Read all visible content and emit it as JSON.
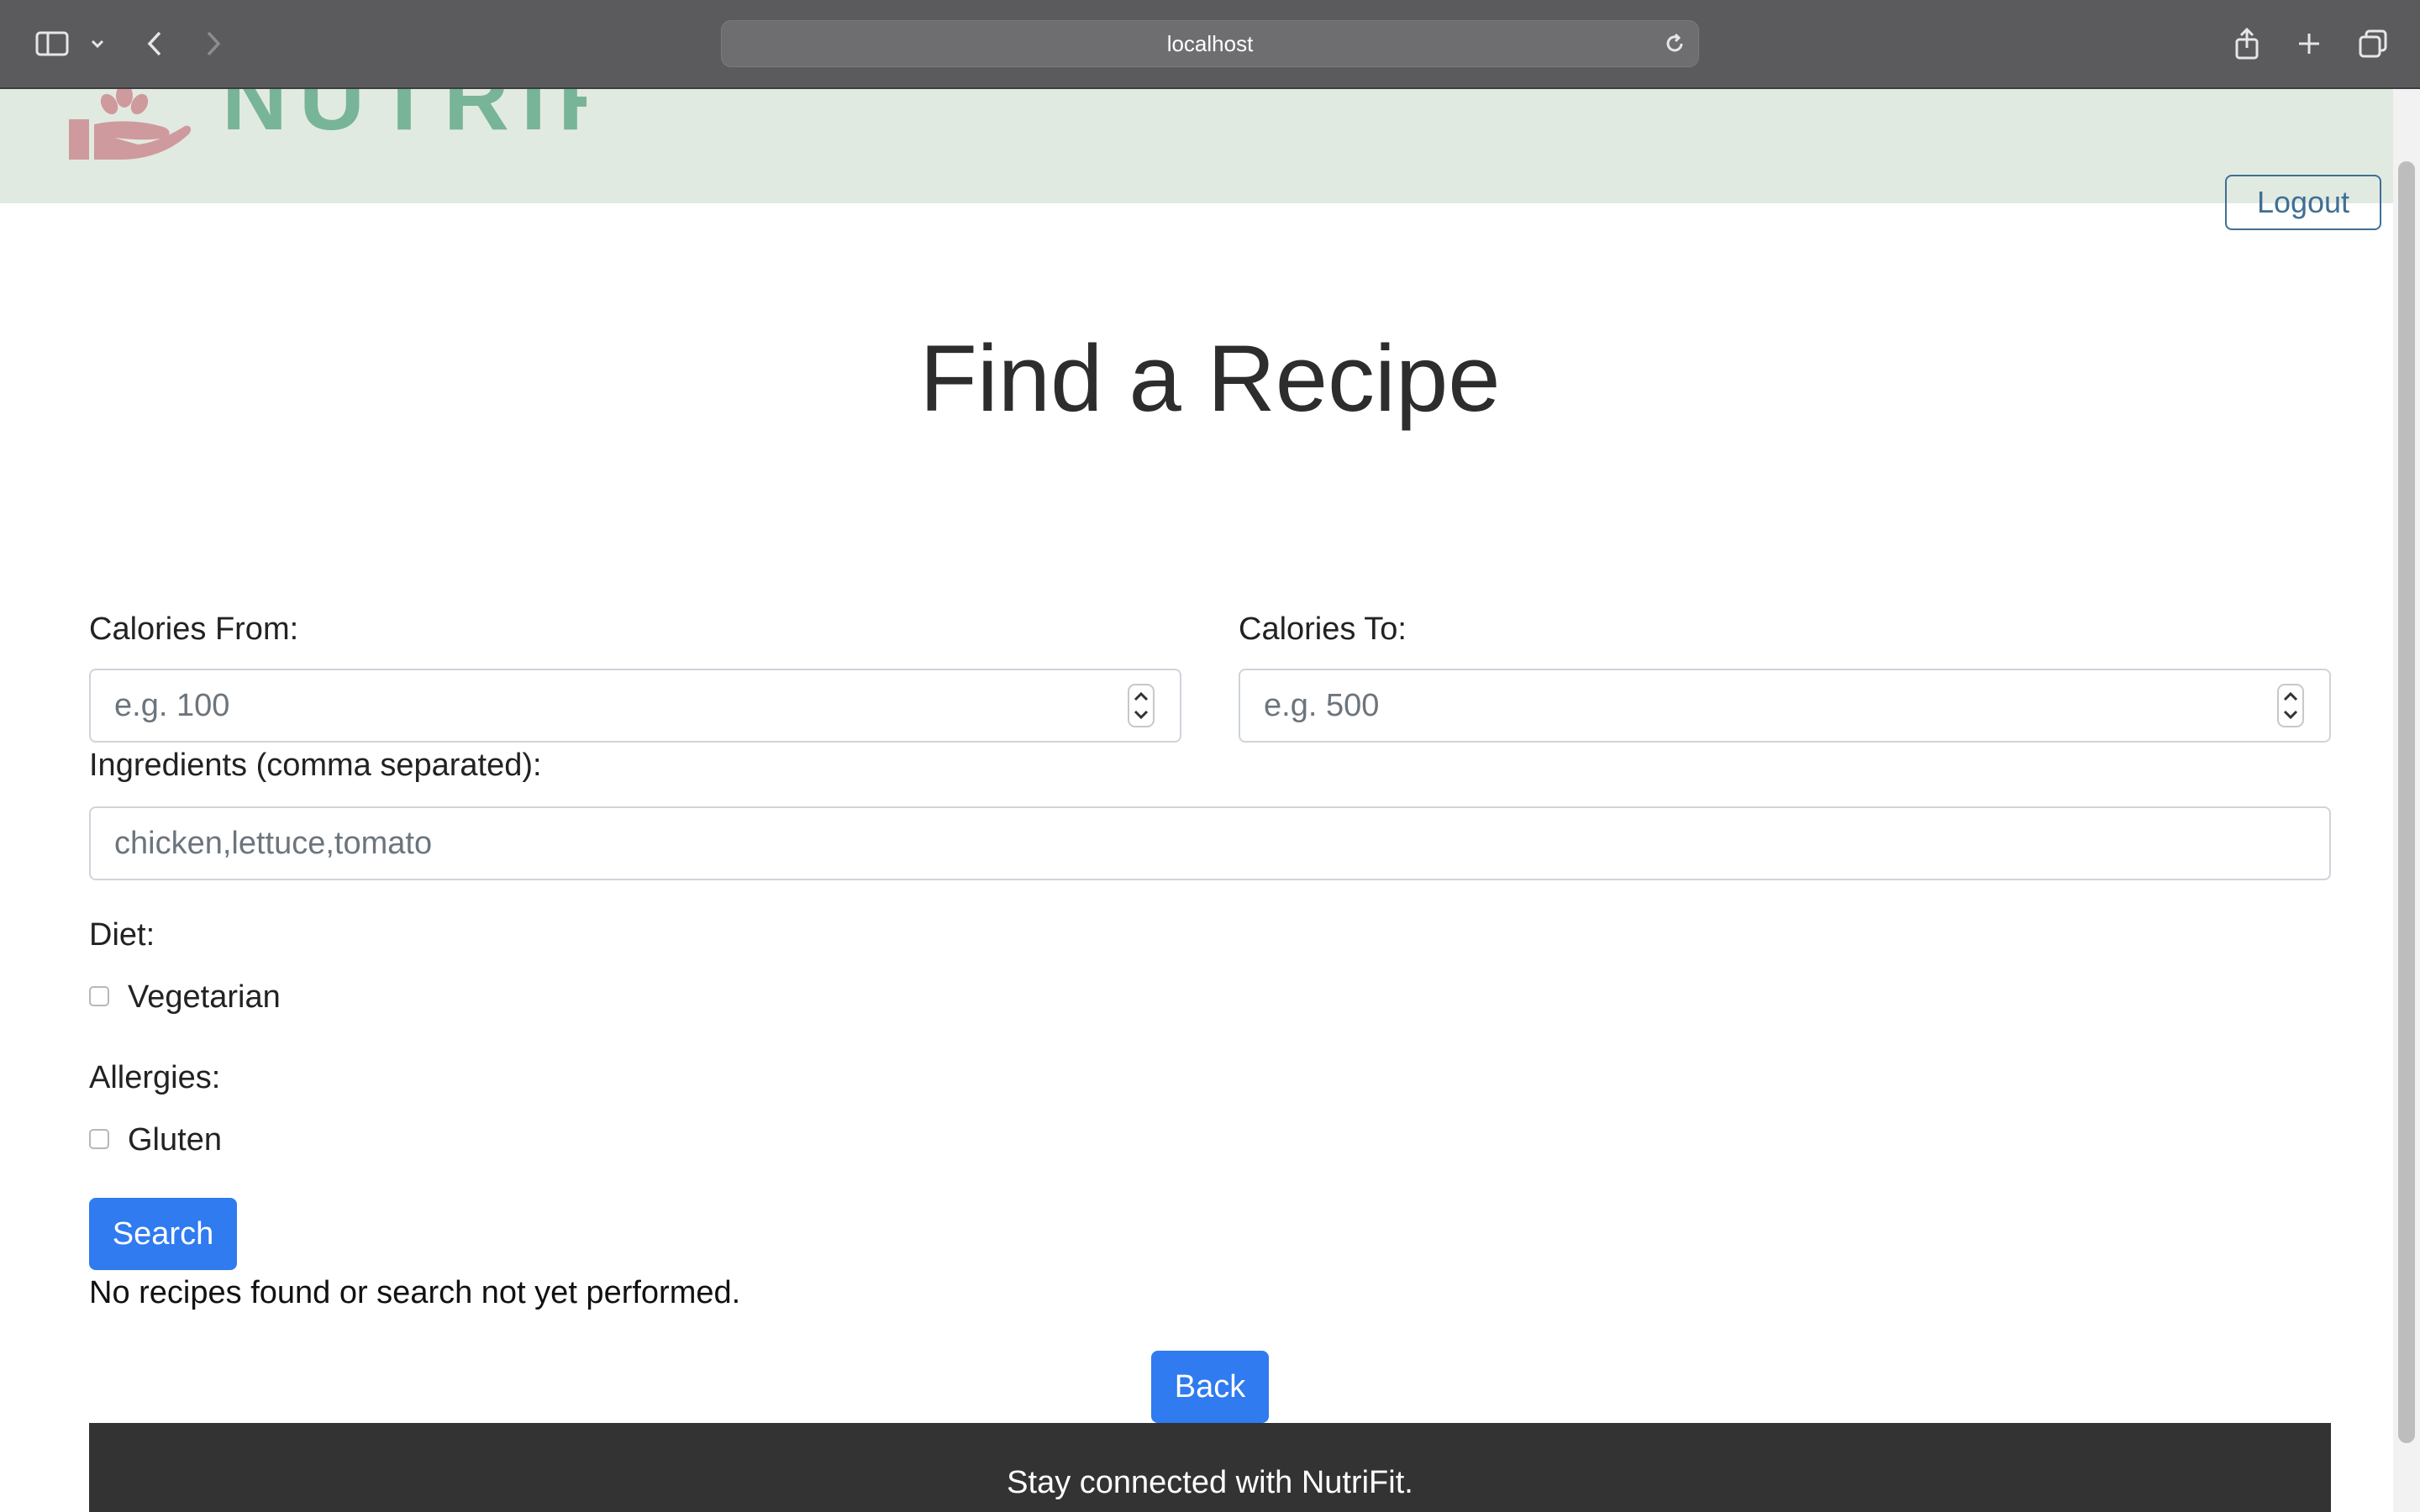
{
  "browser": {
    "url": "localhost"
  },
  "header": {
    "logo_text": "NUTRIFIT",
    "logout_label": "Logout"
  },
  "main": {
    "title": "Find a Recipe",
    "calories_from": {
      "label": "Calories From:",
      "placeholder": "e.g. 100"
    },
    "calories_to": {
      "label": "Calories To:",
      "placeholder": "e.g. 500"
    },
    "ingredients": {
      "label": "Ingredients (comma separated):",
      "placeholder": "chicken,lettuce,tomato"
    },
    "diet": {
      "label": "Diet:",
      "options": [
        {
          "label": "Vegetarian",
          "checked": false
        }
      ]
    },
    "allergies": {
      "label": "Allergies:",
      "options": [
        {
          "label": "Gluten",
          "checked": false
        }
      ]
    },
    "search_label": "Search",
    "status_text": "No recipes found or search not yet performed.",
    "back_label": "Back"
  },
  "footer": {
    "text": "Stay connected with NutriFit."
  },
  "colors": {
    "primary_button": "#2f7bef",
    "header_bg": "#e1eae1",
    "footer_bg": "#333333",
    "logout_border": "#3f6f95"
  }
}
